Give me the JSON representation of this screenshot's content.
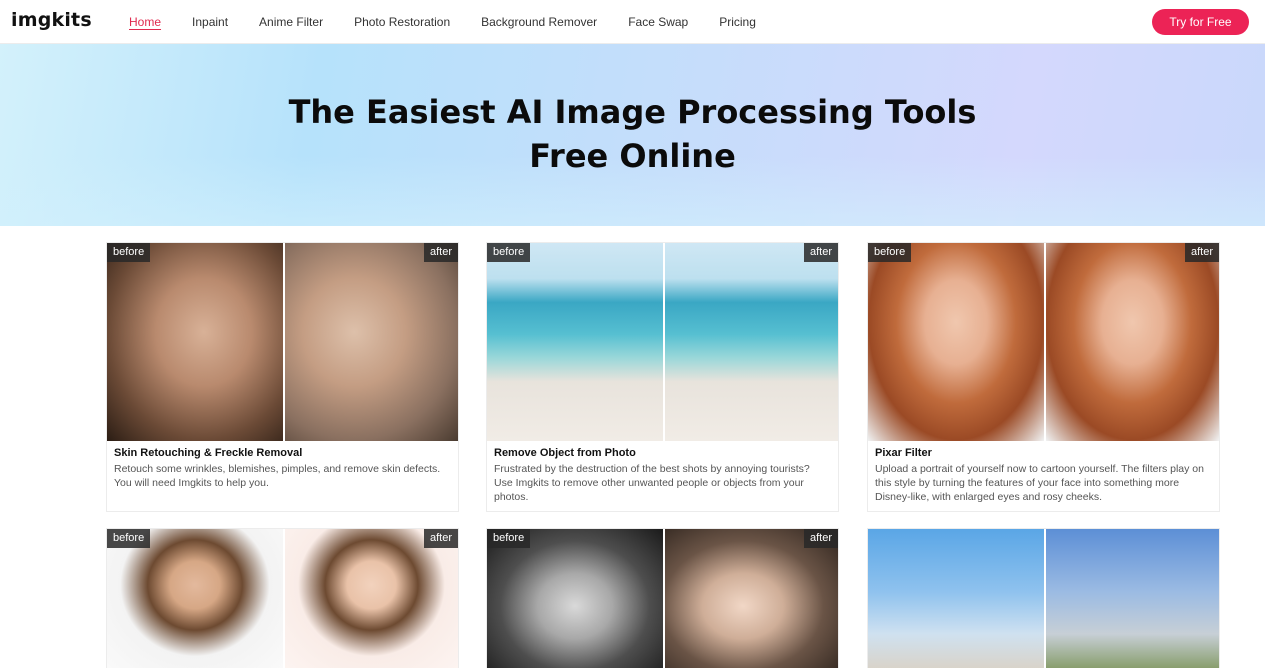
{
  "nav": {
    "logo": "imgkits",
    "items": [
      {
        "label": "Home",
        "active": true
      },
      {
        "label": "Inpaint",
        "active": false
      },
      {
        "label": "Anime Filter",
        "active": false
      },
      {
        "label": "Photo Restoration",
        "active": false
      },
      {
        "label": "Background Remover",
        "active": false
      },
      {
        "label": "Face Swap",
        "active": false
      },
      {
        "label": "Pricing",
        "active": false
      }
    ],
    "cta_label": "Try for Free"
  },
  "hero": {
    "title_line1": "The Easiest AI Image Processing Tools",
    "title_line2": "Free Online"
  },
  "tags": {
    "before": "before",
    "after": "after"
  },
  "cards": [
    {
      "title": "Skin Retouching & Freckle Removal",
      "desc": "Retouch some wrinkles, blemishes, pimples, and remove skin defects. You will need Imgkits to help you."
    },
    {
      "title": "Remove Object from Photo",
      "desc": "Frustrated by the destruction of the best shots by annoying tourists? Use Imgkits to remove other unwanted people or objects from your photos."
    },
    {
      "title": "Pixar Filter",
      "desc": "Upload a portrait of yourself now to cartoon yourself. The filters play on this style by turning the features of your face into something more Disney-like, with enlarged eyes and rosy cheeks."
    },
    {
      "title": "",
      "desc": ""
    },
    {
      "title": "",
      "desc": ""
    },
    {
      "title": "",
      "desc": ""
    }
  ],
  "colors": {
    "accent": "#ec2356",
    "active_link": "#e02a4f"
  }
}
